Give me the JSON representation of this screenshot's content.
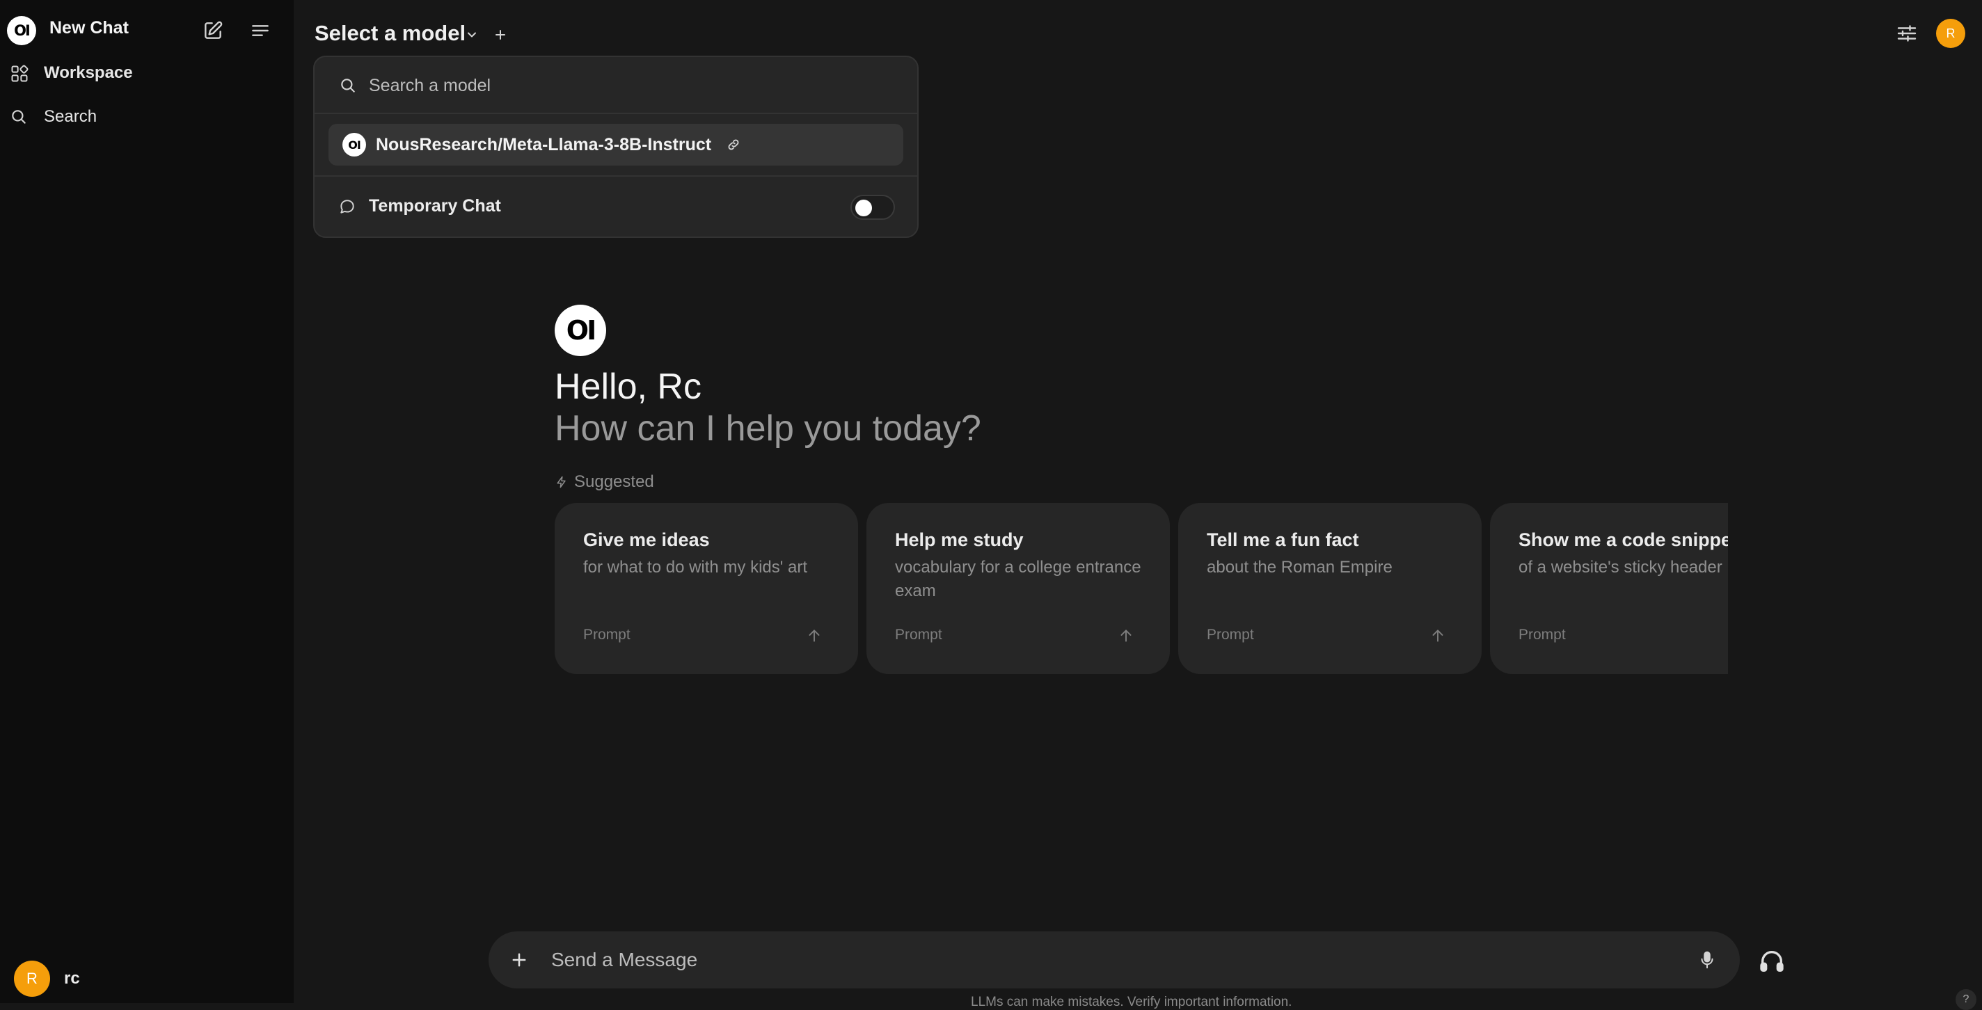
{
  "sidebar": {
    "logo_text": "OI",
    "new_chat_label": "New Chat",
    "items": [
      {
        "label": "Workspace",
        "icon": "workspace-grid-icon"
      },
      {
        "label": "Search",
        "icon": "search-icon"
      }
    ],
    "user": {
      "initial": "R",
      "name": "rc"
    }
  },
  "header": {
    "model_select_label": "Select a model",
    "avatar_initial": "R"
  },
  "model_dropdown": {
    "search_placeholder": "Search a model",
    "models": [
      {
        "logo_text": "OI",
        "name": "NousResearch/Meta-Llama-3-8B-Instruct",
        "icon": "link-icon"
      }
    ],
    "temporary_chat_label": "Temporary Chat",
    "temporary_chat_enabled": false
  },
  "hero": {
    "logo_text": "OI",
    "greeting": "Hello, Rc",
    "subtitle": "How can I help you today?",
    "suggested_label": "Suggested"
  },
  "suggestions": [
    {
      "title": "Give me ideas",
      "subtitle": "for what to do with my kids' art",
      "tag": "Prompt"
    },
    {
      "title": "Help me study",
      "subtitle": "vocabulary for a college entrance exam",
      "tag": "Prompt"
    },
    {
      "title": "Tell me a fun fact",
      "subtitle": "about the Roman Empire",
      "tag": "Prompt"
    },
    {
      "title": "Show me a code snippet",
      "subtitle": "of a website's sticky header",
      "tag": "Prompt"
    }
  ],
  "composer": {
    "placeholder": "Send a Message",
    "disclaimer": "LLMs can make mistakes. Verify important information.",
    "help_label": "?"
  },
  "colors": {
    "background": "#171717",
    "sidebar": "#0d0d0d",
    "card": "#262626",
    "avatar": "#f59e0b"
  }
}
